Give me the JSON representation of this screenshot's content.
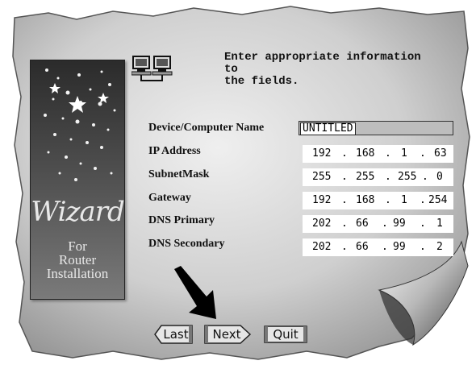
{
  "instruction": {
    "line1": "Enter appropriate information to",
    "line2": "the fields."
  },
  "wizard_panel": {
    "title": "Wizard",
    "subtitle_line1": "For",
    "subtitle_line2": "Router",
    "subtitle_line3": "Installation"
  },
  "fields": {
    "device_name": {
      "label": "Device/Computer Name",
      "value": "UNTITLED"
    },
    "ip_address": {
      "label": "IP Address",
      "octets": [
        "192",
        "168",
        "1",
        "63"
      ]
    },
    "subnet_mask": {
      "label": "SubnetMask",
      "octets": [
        "255",
        "255",
        "255",
        "0"
      ]
    },
    "gateway": {
      "label": "Gateway",
      "octets": [
        "192",
        "168",
        "1",
        "254"
      ]
    },
    "dns_primary": {
      "label": "DNS Primary",
      "octets": [
        "202",
        "66",
        "99",
        "1"
      ]
    },
    "dns_secondary": {
      "label": "DNS Secondary",
      "octets": [
        "202",
        "66",
        "99",
        "2"
      ]
    }
  },
  "buttons": {
    "last": "Last",
    "next": "Next",
    "quit": "Quit"
  },
  "dot": "."
}
